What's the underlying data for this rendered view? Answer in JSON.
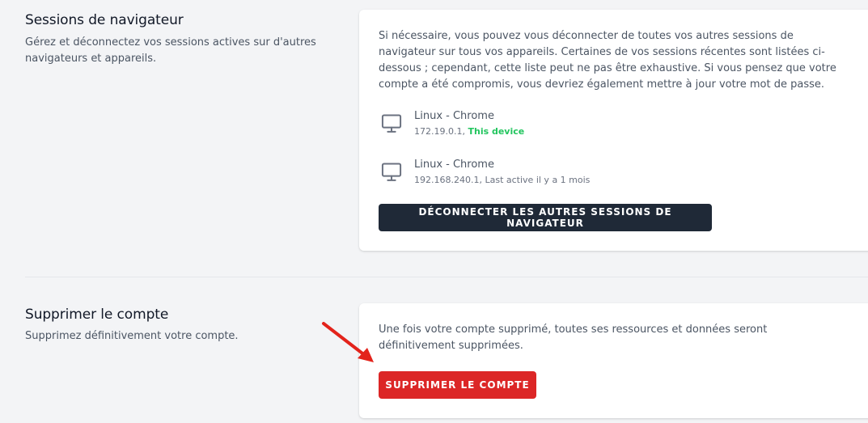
{
  "browser_sessions": {
    "title": "Sessions de navigateur",
    "description": "Gérez et déconnectez vos sessions actives sur d'autres navigateurs et appareils.",
    "info": "Si nécessaire, vous pouvez vous déconnecter de toutes vos autres sessions de navigateur sur tous vos appareils. Certaines de vos sessions récentes sont listées ci-dessous ; cependant, cette liste peut ne pas être exhaustive. Si vous pensez que votre compte a été compromis, vous devriez également mettre à jour votre mot de passe.",
    "sessions": [
      {
        "name": "Linux - Chrome",
        "ip": "172.19.0.1,",
        "status": "This device",
        "icon": "desktop-icon"
      },
      {
        "name": "Linux - Chrome",
        "ip": "192.168.240.1,",
        "status": "Last active il y a 1 mois",
        "icon": "desktop-icon"
      }
    ],
    "logout_button": "Déconnecter les autres sessions de navigateur"
  },
  "delete_account": {
    "title": "Supprimer le compte",
    "description": "Supprimez définitivement votre compte.",
    "info": "Une fois votre compte supprimé, toutes ses ressources et données seront définitivement supprimées.",
    "delete_button": "Supprimer le compte"
  },
  "colors": {
    "background": "#f3f4f6",
    "card": "#ffffff",
    "dark_button": "#1f2937",
    "danger": "#dc2626",
    "this_device": "#22c55e",
    "arrow": "#e3231b"
  }
}
